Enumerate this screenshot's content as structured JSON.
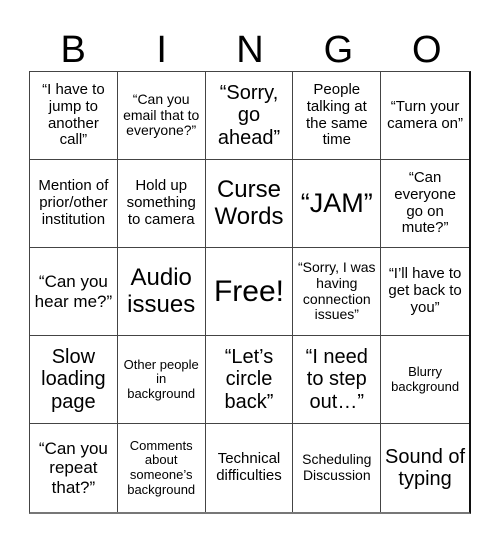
{
  "header": {
    "letters": [
      "B",
      "I",
      "N",
      "G",
      "O"
    ]
  },
  "cells": [
    {
      "text": "“I have to jump to another call”"
    },
    {
      "text": "“Can you email that to everyone?”"
    },
    {
      "text": "“Sorry, go ahead”"
    },
    {
      "text": "People talking at the same time"
    },
    {
      "text": "“Turn your camera on”"
    },
    {
      "text": "Mention of prior/other institution"
    },
    {
      "text": "Hold up something to camera"
    },
    {
      "text": "Curse Words"
    },
    {
      "text": "“JAM”"
    },
    {
      "text": "“Can everyone go on mute?”"
    },
    {
      "text": "“Can you hear me?”"
    },
    {
      "text": "Audio issues"
    },
    {
      "text": "Free!"
    },
    {
      "text": "“Sorry, I was having connection issues”"
    },
    {
      "text": "“I’ll have to get back to you”"
    },
    {
      "text": "Slow loading page"
    },
    {
      "text": "Other people in background"
    },
    {
      "text": "“Let’s circle back”"
    },
    {
      "text": "“I need to step out…”"
    },
    {
      "text": "Blurry background"
    },
    {
      "text": "“Can you repeat that?”"
    },
    {
      "text": "Comments about someone’s background"
    },
    {
      "text": "Technical difficulties"
    },
    {
      "text": "Scheduling Discussion"
    },
    {
      "text": "Sound of typing"
    }
  ]
}
